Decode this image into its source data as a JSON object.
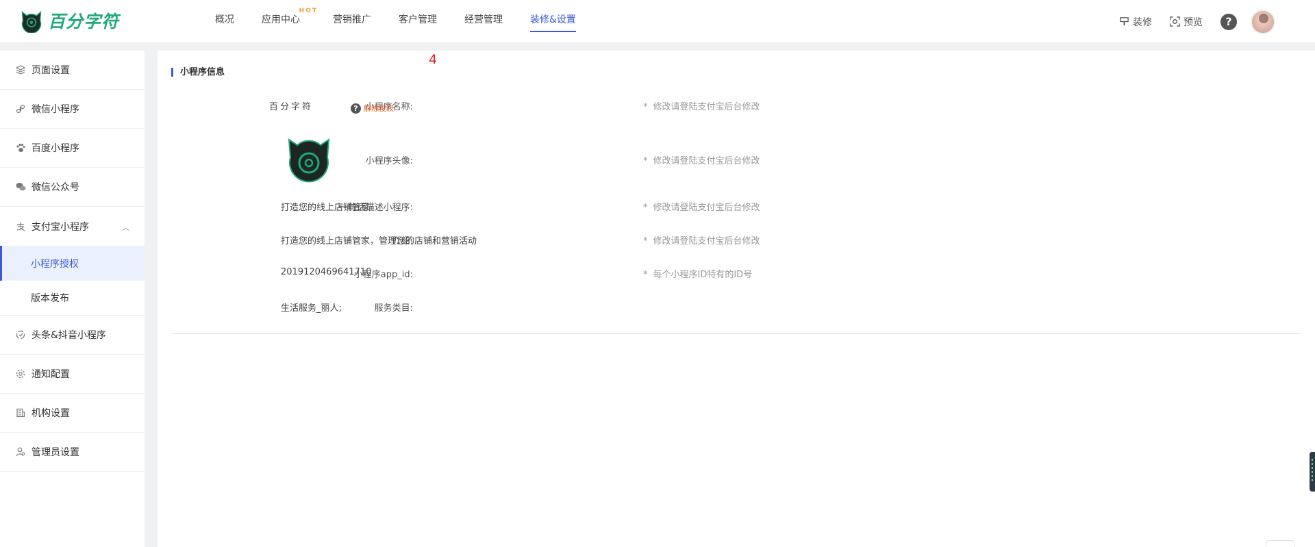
{
  "brand": {
    "name": "百分字符"
  },
  "nav": {
    "items": [
      {
        "label": "概况"
      },
      {
        "label": "应用中心",
        "badge": "HOT"
      },
      {
        "label": "营销推广"
      },
      {
        "label": "客户管理"
      },
      {
        "label": "经营管理"
      },
      {
        "label": "装修&设置",
        "active": true
      }
    ]
  },
  "top_actions": {
    "decorate": "装修",
    "preview": "预览",
    "help": "?"
  },
  "sidebar": {
    "items": [
      {
        "label": "页面设置",
        "icon": "layers-icon"
      },
      {
        "label": "微信小程序",
        "icon": "miniprogram-icon"
      },
      {
        "label": "百度小程序",
        "icon": "paw-icon"
      },
      {
        "label": "微信公众号",
        "icon": "wechat-icon"
      },
      {
        "label": "支付宝小程序",
        "icon": "alipay-icon",
        "expanded": true,
        "children": [
          {
            "label": "小程序授权",
            "active": true
          },
          {
            "label": "版本发布"
          }
        ]
      },
      {
        "label": "头条&抖音小程序",
        "icon": "toutiao-icon"
      },
      {
        "label": "通知配置",
        "icon": "gear-icon"
      },
      {
        "label": "机构设置",
        "icon": "building-icon"
      },
      {
        "label": "管理员设置",
        "icon": "user-icon"
      }
    ]
  },
  "main": {
    "badge": "4",
    "section_title": "小程序信息",
    "unauthorize_label": "解除授权",
    "rows": {
      "name": {
        "label": "小程序名称:",
        "value": "百分字符",
        "hint": "修改请登陆支付宝后台修改"
      },
      "avatar": {
        "label": "小程序头像:",
        "hint": "修改请登陆支付宝后台修改"
      },
      "slogan": {
        "label": "一句话描述小程序:",
        "value": "打造您的线上店铺管家",
        "hint": "修改请登陆支付宝后台修改"
      },
      "intro": {
        "label": "介绍:",
        "value": "打造您的线上店铺管家，管理您的店铺和营销活动",
        "hint": "修改请登陆支付宝后台修改"
      },
      "appid": {
        "label": "小程序app_id:",
        "value": "2019120469641710",
        "hint": "每个小程序ID特有的ID号"
      },
      "category": {
        "label": "服务类目:",
        "value": "生活服务_丽人;"
      }
    },
    "hint_star": "*"
  },
  "colors": {
    "accent": "#3a5ad9",
    "brand_green": "#1fa97a",
    "warning": "#e8642a",
    "badge_red": "#e02020"
  }
}
